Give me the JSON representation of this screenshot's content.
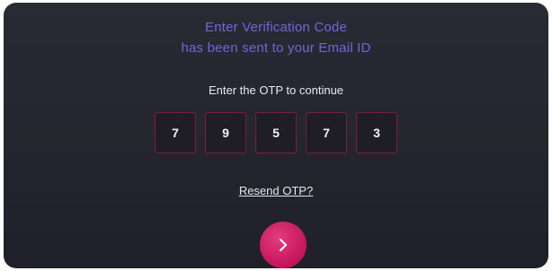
{
  "header": {
    "title_line1": "Enter Verification Code",
    "title_line2": "has been sent to your Email ID"
  },
  "otp": {
    "prompt": "Enter the OTP to continue",
    "digits": [
      "7",
      "9",
      "5",
      "7",
      "3"
    ]
  },
  "resend_label": "Resend OTP?",
  "next_button": {
    "icon": "chevron-right-icon"
  },
  "colors": {
    "background": "#26262f",
    "title": "#6f66d8",
    "otp_border": "#7a1f3a",
    "button": "#c4155a"
  }
}
